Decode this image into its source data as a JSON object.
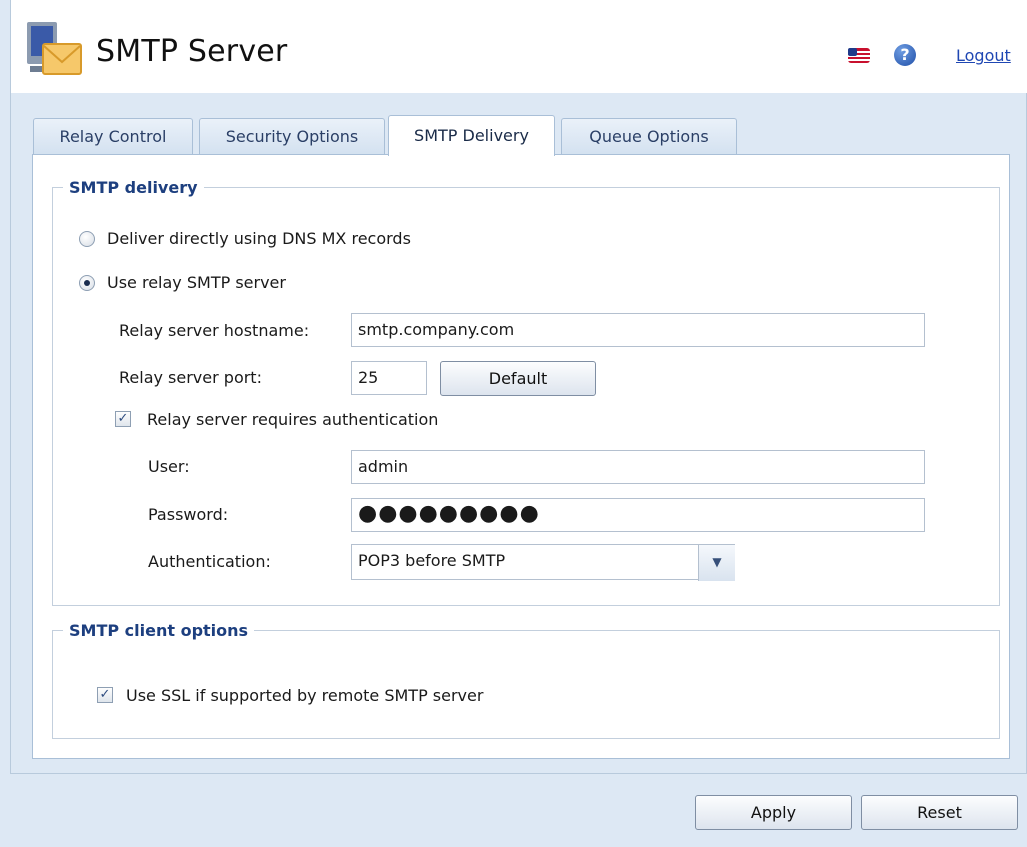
{
  "header": {
    "title": "SMTP Server",
    "flag_icon": "us-flag-icon",
    "help_icon": "help-icon",
    "help_glyph": "?",
    "logout_label": "Logout"
  },
  "tabs": [
    {
      "label": "Relay Control",
      "active": false
    },
    {
      "label": "Security Options",
      "active": false
    },
    {
      "label": "SMTP Delivery",
      "active": true
    },
    {
      "label": "Queue Options",
      "active": false
    }
  ],
  "delivery": {
    "legend": "SMTP delivery",
    "direct_label": "Deliver directly using DNS MX records",
    "relay_label": "Use relay SMTP server",
    "hostname_label": "Relay server hostname:",
    "hostname_value": "smtp.company.com",
    "port_label": "Relay server port:",
    "port_value": "25",
    "default_button": "Default",
    "auth_required_label": "Relay server requires authentication",
    "user_label": "User:",
    "user_value": "admin",
    "password_label": "Password:",
    "password_value": "●●●●●●●●●",
    "authentication_label": "Authentication:",
    "authentication_value": "POP3 before SMTP"
  },
  "client": {
    "legend": "SMTP client options",
    "ssl_label": "Use SSL if supported by remote SMTP server"
  },
  "buttons": {
    "apply": "Apply",
    "reset": "Reset"
  },
  "colors": {
    "background": "#dde8f4",
    "legend_blue": "#1d3f7f",
    "link_blue": "#1f47b3"
  }
}
